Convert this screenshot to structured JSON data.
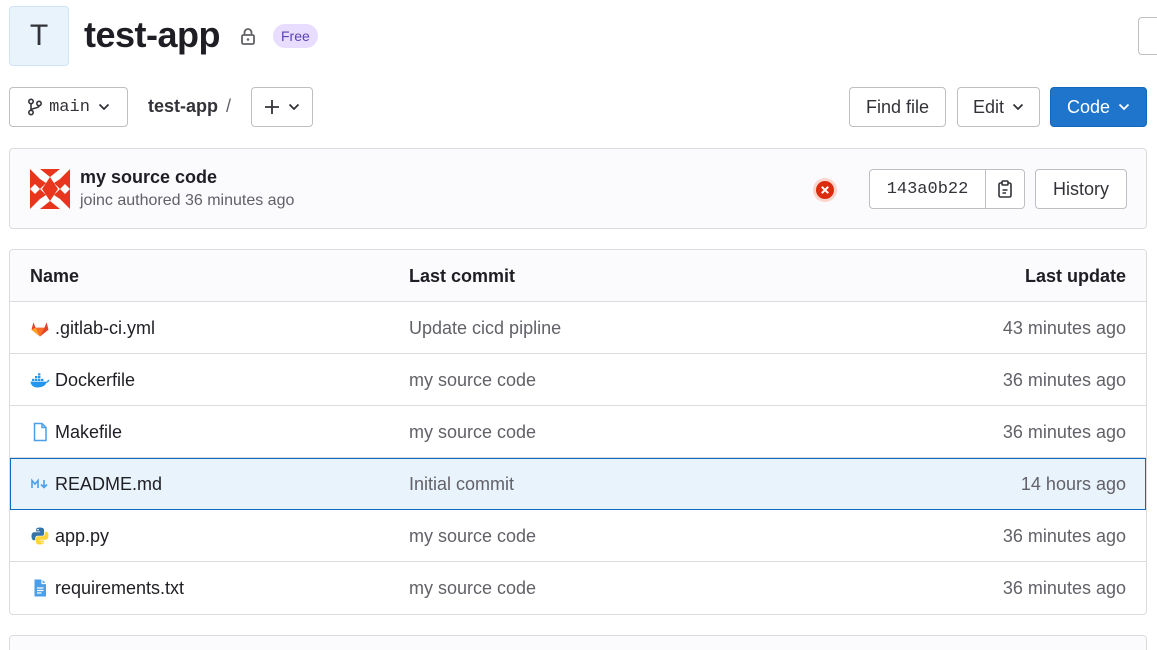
{
  "project": {
    "avatar_letter": "T",
    "name": "test-app",
    "badge": "Free"
  },
  "toolbar": {
    "branch": "main",
    "breadcrumb_root": "test-app",
    "breadcrumb_sep": "/",
    "find_file_label": "Find file",
    "edit_label": "Edit",
    "code_label": "Code"
  },
  "last_commit": {
    "title": "my source code",
    "meta": "joinc authored 36 minutes ago",
    "pipeline_status": "failed",
    "sha": "143a0b22",
    "history_label": "History"
  },
  "files": {
    "headers": {
      "name": "Name",
      "last_commit": "Last commit",
      "last_update": "Last update"
    },
    "rows": [
      {
        "name": ".gitlab-ci.yml",
        "icon": "gitlab-icon",
        "commit": "Update cicd pipline",
        "updated": "43 minutes ago"
      },
      {
        "name": "Dockerfile",
        "icon": "docker-icon",
        "commit": "my source code",
        "updated": "36 minutes ago"
      },
      {
        "name": "Makefile",
        "icon": "file-icon",
        "commit": "my source code",
        "updated": "36 minutes ago"
      },
      {
        "name": "README.md",
        "icon": "markdown-icon",
        "commit": "Initial commit",
        "updated": "14 hours ago"
      },
      {
        "name": "app.py",
        "icon": "python-icon",
        "commit": "my source code",
        "updated": "36 minutes ago"
      },
      {
        "name": "requirements.txt",
        "icon": "text-file-icon",
        "commit": "my source code",
        "updated": "36 minutes ago"
      }
    ]
  },
  "colors": {
    "primary": "#1f75cb",
    "badge_bg": "#e8ddff",
    "badge_text": "#5943b6",
    "failed": "#dd2b0e",
    "selected_row": "#e9f3fc"
  }
}
